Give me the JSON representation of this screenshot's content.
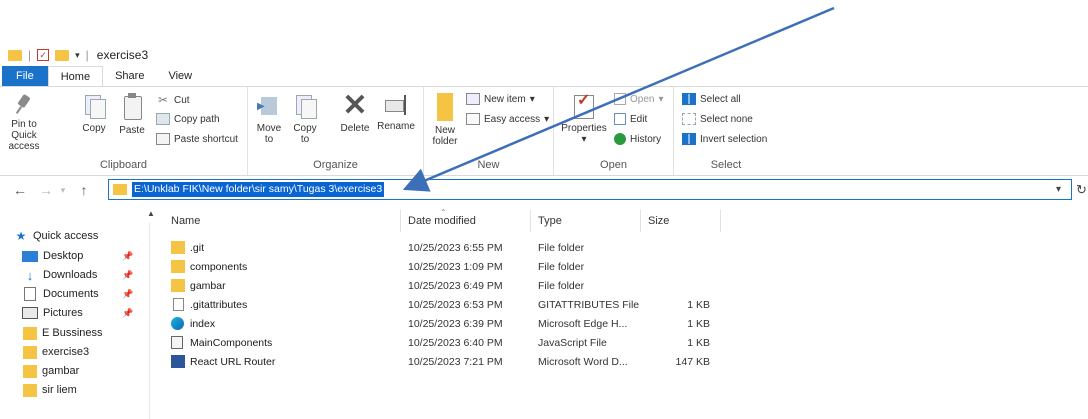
{
  "window": {
    "title": "exercise3"
  },
  "menu": {
    "tabs": [
      "File",
      "Home",
      "Share",
      "View"
    ]
  },
  "ribbon": {
    "clipboard": {
      "pin_label": "Pin to Quick access",
      "copy_label": "Copy",
      "paste_label": "Paste",
      "cut_label": "Cut",
      "copy_path_label": "Copy path",
      "paste_shortcut_label": "Paste shortcut",
      "group_label": "Clipboard"
    },
    "organize": {
      "move_label": "Move to",
      "copy_label": "Copy to",
      "delete_label": "Delete",
      "rename_label": "Rename",
      "group_label": "Organize"
    },
    "new": {
      "new_folder_label": "New folder",
      "new_item_label": "New item",
      "easy_access_label": "Easy access",
      "group_label": "New"
    },
    "open": {
      "properties_label": "Properties",
      "open_label": "Open",
      "edit_label": "Edit",
      "history_label": "History",
      "group_label": "Open"
    },
    "select": {
      "select_all_label": "Select all",
      "select_none_label": "Select none",
      "invert_selection_label": "Invert selection",
      "group_label": "Select"
    }
  },
  "address": {
    "path": "E:\\Unklab FIK\\New folder\\sir samy\\Tugas 3\\exercise3"
  },
  "navpane": {
    "quick_access": "Quick access",
    "items": [
      {
        "label": "Desktop",
        "icon": "desktop-icon",
        "pinned": true
      },
      {
        "label": "Downloads",
        "icon": "download-icon",
        "pinned": true
      },
      {
        "label": "Documents",
        "icon": "documents-icon",
        "pinned": true
      },
      {
        "label": "Pictures",
        "icon": "pictures-icon",
        "pinned": true
      },
      {
        "label": "E Bussiness",
        "icon": "folder-icon",
        "pinned": false
      },
      {
        "label": "exercise3",
        "icon": "folder-icon",
        "pinned": false
      },
      {
        "label": "gambar",
        "icon": "folder-icon",
        "pinned": false
      },
      {
        "label": "sir liem",
        "icon": "folder-icon",
        "pinned": false
      }
    ]
  },
  "filelist": {
    "columns": {
      "name": "Name",
      "date": "Date modified",
      "type": "Type",
      "size": "Size"
    },
    "rows": [
      {
        "name": ".git",
        "date": "10/25/2023 6:55 PM",
        "type": "File folder",
        "size": "",
        "icon": "folder-icon"
      },
      {
        "name": "components",
        "date": "10/25/2023 1:09 PM",
        "type": "File folder",
        "size": "",
        "icon": "folder-icon"
      },
      {
        "name": "gambar",
        "date": "10/25/2023 6:49 PM",
        "type": "File folder",
        "size": "",
        "icon": "folder-icon"
      },
      {
        "name": ".gitattributes",
        "date": "10/25/2023 6:53 PM",
        "type": "GITATTRIBUTES File",
        "size": "1 KB",
        "icon": "file-icon"
      },
      {
        "name": "index",
        "date": "10/25/2023 6:39 PM",
        "type": "Microsoft Edge H...",
        "size": "1 KB",
        "icon": "edge-icon"
      },
      {
        "name": "MainComponents",
        "date": "10/25/2023 6:40 PM",
        "type": "JavaScript File",
        "size": "1 KB",
        "icon": "js-file-icon"
      },
      {
        "name": "React URL Router",
        "date": "10/25/2023 7:21 PM",
        "type": "Microsoft Word D...",
        "size": "147 KB",
        "icon": "word-icon"
      }
    ]
  },
  "colors": {
    "accent": "#1a73c8",
    "folder": "#f6c445",
    "annotation_arrow": "#3d6fb8"
  }
}
